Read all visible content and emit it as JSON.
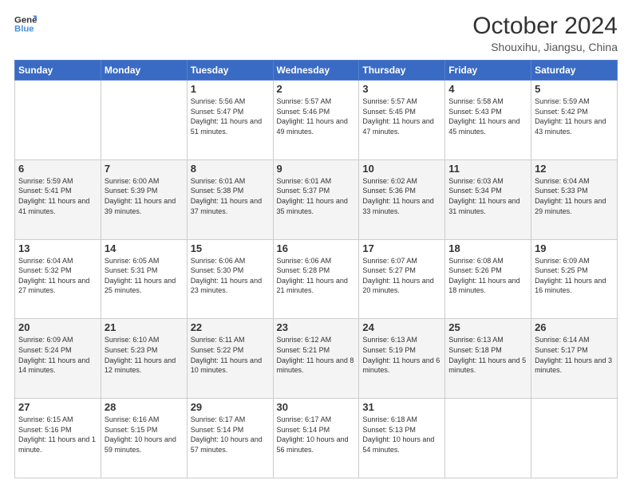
{
  "header": {
    "logo_line1": "General",
    "logo_line2": "Blue",
    "title": "October 2024",
    "subtitle": "Shouxihu, Jiangsu, China"
  },
  "columns": [
    "Sunday",
    "Monday",
    "Tuesday",
    "Wednesday",
    "Thursday",
    "Friday",
    "Saturday"
  ],
  "weeks": [
    [
      {
        "day": "",
        "sunrise": "",
        "sunset": "",
        "daylight": ""
      },
      {
        "day": "",
        "sunrise": "",
        "sunset": "",
        "daylight": ""
      },
      {
        "day": "1",
        "sunrise": "Sunrise: 5:56 AM",
        "sunset": "Sunset: 5:47 PM",
        "daylight": "Daylight: 11 hours and 51 minutes."
      },
      {
        "day": "2",
        "sunrise": "Sunrise: 5:57 AM",
        "sunset": "Sunset: 5:46 PM",
        "daylight": "Daylight: 11 hours and 49 minutes."
      },
      {
        "day": "3",
        "sunrise": "Sunrise: 5:57 AM",
        "sunset": "Sunset: 5:45 PM",
        "daylight": "Daylight: 11 hours and 47 minutes."
      },
      {
        "day": "4",
        "sunrise": "Sunrise: 5:58 AM",
        "sunset": "Sunset: 5:43 PM",
        "daylight": "Daylight: 11 hours and 45 minutes."
      },
      {
        "day": "5",
        "sunrise": "Sunrise: 5:59 AM",
        "sunset": "Sunset: 5:42 PM",
        "daylight": "Daylight: 11 hours and 43 minutes."
      }
    ],
    [
      {
        "day": "6",
        "sunrise": "Sunrise: 5:59 AM",
        "sunset": "Sunset: 5:41 PM",
        "daylight": "Daylight: 11 hours and 41 minutes."
      },
      {
        "day": "7",
        "sunrise": "Sunrise: 6:00 AM",
        "sunset": "Sunset: 5:39 PM",
        "daylight": "Daylight: 11 hours and 39 minutes."
      },
      {
        "day": "8",
        "sunrise": "Sunrise: 6:01 AM",
        "sunset": "Sunset: 5:38 PM",
        "daylight": "Daylight: 11 hours and 37 minutes."
      },
      {
        "day": "9",
        "sunrise": "Sunrise: 6:01 AM",
        "sunset": "Sunset: 5:37 PM",
        "daylight": "Daylight: 11 hours and 35 minutes."
      },
      {
        "day": "10",
        "sunrise": "Sunrise: 6:02 AM",
        "sunset": "Sunset: 5:36 PM",
        "daylight": "Daylight: 11 hours and 33 minutes."
      },
      {
        "day": "11",
        "sunrise": "Sunrise: 6:03 AM",
        "sunset": "Sunset: 5:34 PM",
        "daylight": "Daylight: 11 hours and 31 minutes."
      },
      {
        "day": "12",
        "sunrise": "Sunrise: 6:04 AM",
        "sunset": "Sunset: 5:33 PM",
        "daylight": "Daylight: 11 hours and 29 minutes."
      }
    ],
    [
      {
        "day": "13",
        "sunrise": "Sunrise: 6:04 AM",
        "sunset": "Sunset: 5:32 PM",
        "daylight": "Daylight: 11 hours and 27 minutes."
      },
      {
        "day": "14",
        "sunrise": "Sunrise: 6:05 AM",
        "sunset": "Sunset: 5:31 PM",
        "daylight": "Daylight: 11 hours and 25 minutes."
      },
      {
        "day": "15",
        "sunrise": "Sunrise: 6:06 AM",
        "sunset": "Sunset: 5:30 PM",
        "daylight": "Daylight: 11 hours and 23 minutes."
      },
      {
        "day": "16",
        "sunrise": "Sunrise: 6:06 AM",
        "sunset": "Sunset: 5:28 PM",
        "daylight": "Daylight: 11 hours and 21 minutes."
      },
      {
        "day": "17",
        "sunrise": "Sunrise: 6:07 AM",
        "sunset": "Sunset: 5:27 PM",
        "daylight": "Daylight: 11 hours and 20 minutes."
      },
      {
        "day": "18",
        "sunrise": "Sunrise: 6:08 AM",
        "sunset": "Sunset: 5:26 PM",
        "daylight": "Daylight: 11 hours and 18 minutes."
      },
      {
        "day": "19",
        "sunrise": "Sunrise: 6:09 AM",
        "sunset": "Sunset: 5:25 PM",
        "daylight": "Daylight: 11 hours and 16 minutes."
      }
    ],
    [
      {
        "day": "20",
        "sunrise": "Sunrise: 6:09 AM",
        "sunset": "Sunset: 5:24 PM",
        "daylight": "Daylight: 11 hours and 14 minutes."
      },
      {
        "day": "21",
        "sunrise": "Sunrise: 6:10 AM",
        "sunset": "Sunset: 5:23 PM",
        "daylight": "Daylight: 11 hours and 12 minutes."
      },
      {
        "day": "22",
        "sunrise": "Sunrise: 6:11 AM",
        "sunset": "Sunset: 5:22 PM",
        "daylight": "Daylight: 11 hours and 10 minutes."
      },
      {
        "day": "23",
        "sunrise": "Sunrise: 6:12 AM",
        "sunset": "Sunset: 5:21 PM",
        "daylight": "Daylight: 11 hours and 8 minutes."
      },
      {
        "day": "24",
        "sunrise": "Sunrise: 6:13 AM",
        "sunset": "Sunset: 5:19 PM",
        "daylight": "Daylight: 11 hours and 6 minutes."
      },
      {
        "day": "25",
        "sunrise": "Sunrise: 6:13 AM",
        "sunset": "Sunset: 5:18 PM",
        "daylight": "Daylight: 11 hours and 5 minutes."
      },
      {
        "day": "26",
        "sunrise": "Sunrise: 6:14 AM",
        "sunset": "Sunset: 5:17 PM",
        "daylight": "Daylight: 11 hours and 3 minutes."
      }
    ],
    [
      {
        "day": "27",
        "sunrise": "Sunrise: 6:15 AM",
        "sunset": "Sunset: 5:16 PM",
        "daylight": "Daylight: 11 hours and 1 minute."
      },
      {
        "day": "28",
        "sunrise": "Sunrise: 6:16 AM",
        "sunset": "Sunset: 5:15 PM",
        "daylight": "Daylight: 10 hours and 59 minutes."
      },
      {
        "day": "29",
        "sunrise": "Sunrise: 6:17 AM",
        "sunset": "Sunset: 5:14 PM",
        "daylight": "Daylight: 10 hours and 57 minutes."
      },
      {
        "day": "30",
        "sunrise": "Sunrise: 6:17 AM",
        "sunset": "Sunset: 5:14 PM",
        "daylight": "Daylight: 10 hours and 56 minutes."
      },
      {
        "day": "31",
        "sunrise": "Sunrise: 6:18 AM",
        "sunset": "Sunset: 5:13 PM",
        "daylight": "Daylight: 10 hours and 54 minutes."
      },
      {
        "day": "",
        "sunrise": "",
        "sunset": "",
        "daylight": ""
      },
      {
        "day": "",
        "sunrise": "",
        "sunset": "",
        "daylight": ""
      }
    ]
  ]
}
